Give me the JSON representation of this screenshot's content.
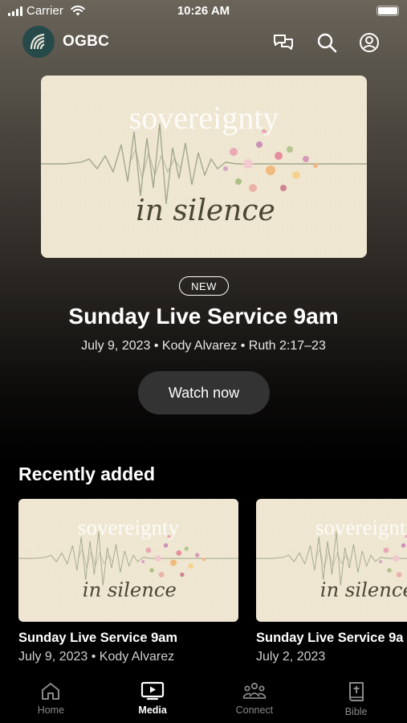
{
  "status_bar": {
    "carrier": "Carrier",
    "time": "10:26 AM"
  },
  "header": {
    "brand": "OGBC"
  },
  "hero": {
    "art_text_top": "sovereignty",
    "art_text_bottom": "in silence",
    "badge": "NEW",
    "title": "Sunday Live Service 9am",
    "meta": "July 9, 2023 • Kody Alvarez • Ruth 2:17–23",
    "button": "Watch now"
  },
  "recent": {
    "title": "Recently added",
    "items": [
      {
        "title": "Sunday Live Service 9am",
        "meta": "July 9, 2023 • Kody Alvarez"
      },
      {
        "title": "Sunday Live Service 9a",
        "meta": "July 2, 2023"
      }
    ]
  },
  "tabs": [
    {
      "label": "Home",
      "icon": "home-icon"
    },
    {
      "label": "Media",
      "icon": "media-icon",
      "active": true
    },
    {
      "label": "Connect",
      "icon": "connect-icon"
    },
    {
      "label": "Bible",
      "icon": "bible-icon"
    }
  ],
  "colors": {
    "accent": "#ffffff",
    "button_bg": "#333333",
    "art_bg": "#efe7d2",
    "logo_bg": "#264a4a"
  }
}
